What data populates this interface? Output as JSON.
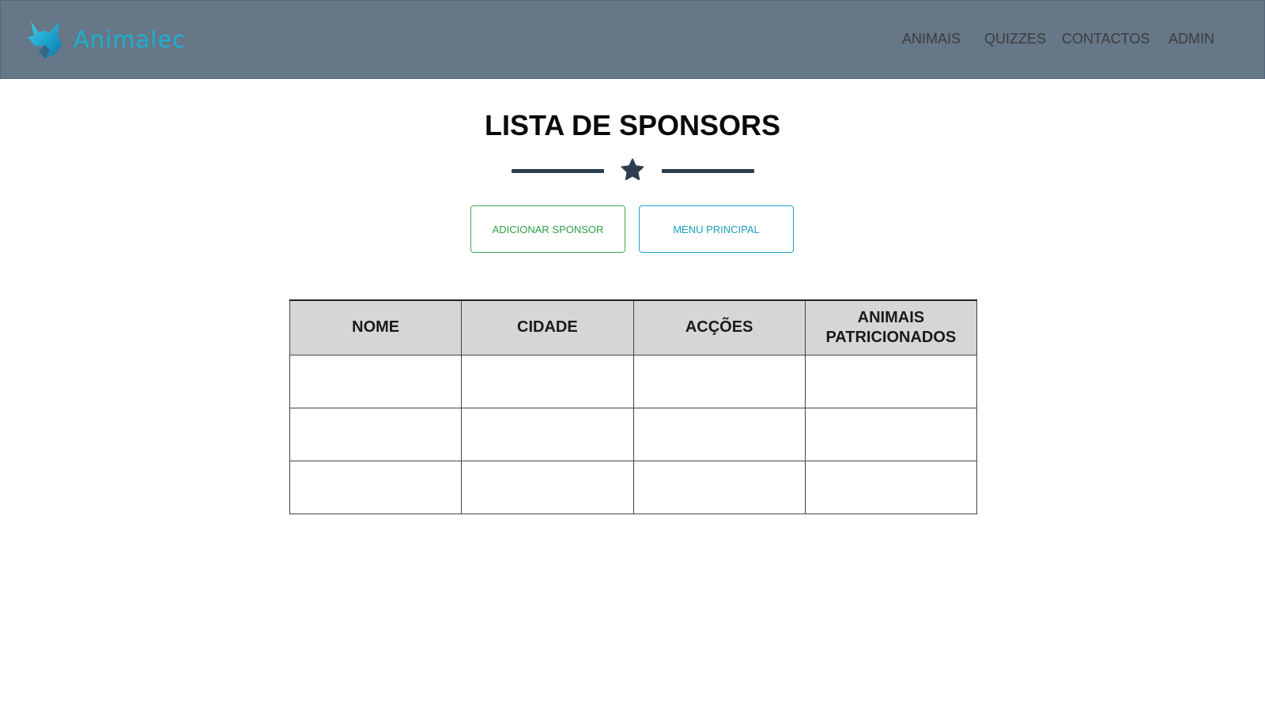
{
  "brand": {
    "name": "Animalec",
    "logo_icon": "fox-head-icon",
    "color": "#1bb0d2"
  },
  "nav": {
    "items": [
      {
        "label": "ANIMAIS"
      },
      {
        "label": "QUIZZES"
      },
      {
        "label": "CONTACTOS"
      },
      {
        "label": "ADMIN"
      }
    ]
  },
  "page": {
    "title": "LISTA DE SPONSORS",
    "divider_icon": "star-icon"
  },
  "actions": {
    "add_label": "ADICIONAR SPONSOR",
    "menu_label": "MENU PRINCIPAL"
  },
  "table": {
    "columns": [
      "NOME",
      "CIDADE",
      "ACÇÕES",
      "ANIMAIS PATRICIONADOS"
    ],
    "rows": [
      [
        "",
        "",
        "",
        ""
      ],
      [
        "",
        "",
        "",
        ""
      ],
      [
        "",
        "",
        "",
        ""
      ]
    ]
  },
  "colors": {
    "navbar_bg": "#667788",
    "add_button": "#2f9e47",
    "menu_button": "#1a9fbc",
    "divider": "#2c3e50"
  }
}
